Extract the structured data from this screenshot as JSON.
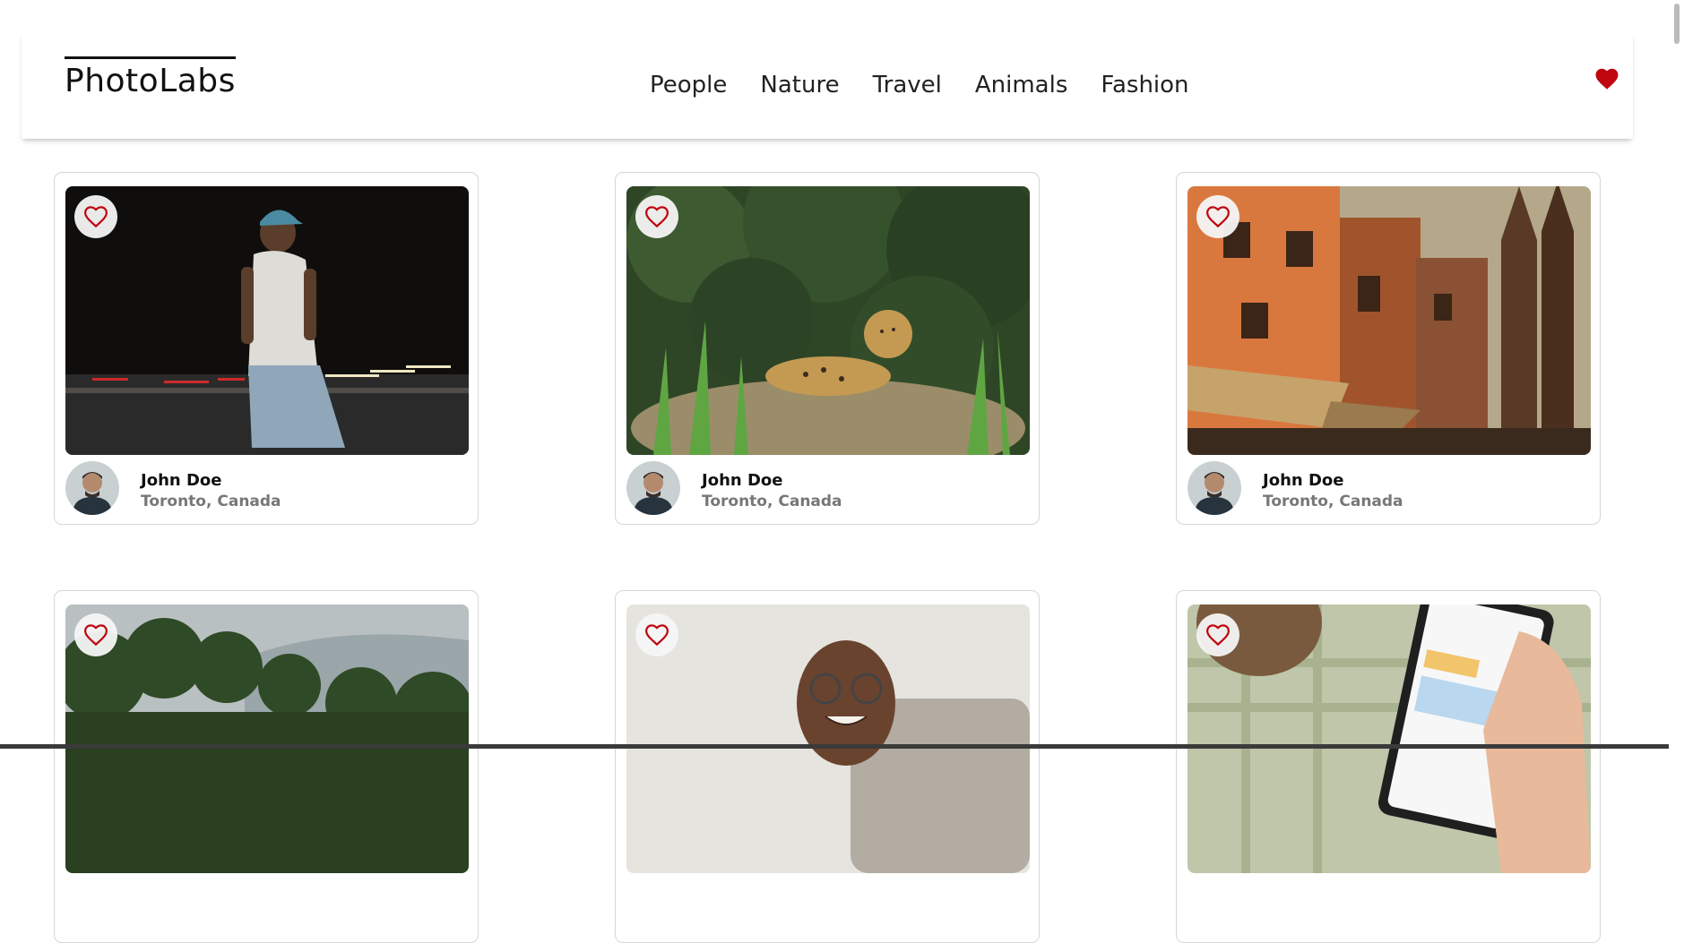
{
  "header": {
    "logo": "PhotoLabs",
    "nav": [
      "People",
      "Nature",
      "Travel",
      "Animals",
      "Fashion"
    ],
    "fav_icon": "heart-icon",
    "accent": "#c0070f"
  },
  "photos": [
    {
      "name": "John Doe",
      "location": "Toronto, Canada"
    },
    {
      "name": "John Doe",
      "location": "Toronto, Canada"
    },
    {
      "name": "John Doe",
      "location": "Toronto, Canada"
    },
    {
      "name": "",
      "location": ""
    },
    {
      "name": "",
      "location": ""
    },
    {
      "name": "",
      "location": ""
    }
  ]
}
